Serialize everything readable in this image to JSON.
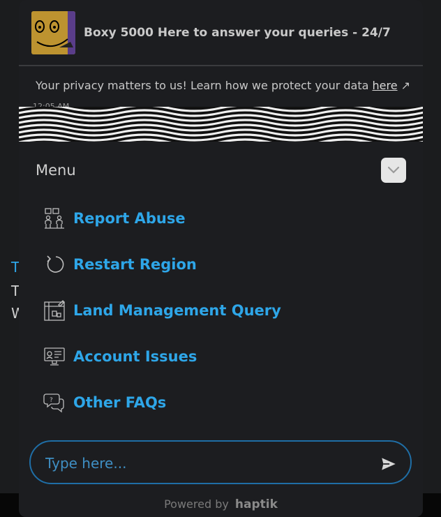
{
  "background": {
    "lines": [
      "T",
      "T",
      "W"
    ]
  },
  "header": {
    "title": "Boxy 5000 Here to answer your queries - 24/7",
    "avatar_icon": "boxy-avatar-icon"
  },
  "privacy": {
    "text": "Your privacy matters to us! Learn how we protect your data ",
    "link_label": "here",
    "arrow": "↗"
  },
  "chat": {
    "timestamp": "12:05 AM"
  },
  "menu": {
    "title": "Menu",
    "collapse_icon": "chevron-down-icon",
    "items": [
      {
        "label": "Report Abuse",
        "icon": "report-abuse-icon"
      },
      {
        "label": "Restart Region",
        "icon": "restart-icon"
      },
      {
        "label": "Land Management Query",
        "icon": "land-management-icon"
      },
      {
        "label": "Account Issues",
        "icon": "account-issues-icon"
      },
      {
        "label": "Other FAQs",
        "icon": "faq-chat-icon"
      }
    ]
  },
  "composer": {
    "placeholder": "Type here...",
    "send_icon": "send-icon"
  },
  "footer": {
    "powered_by": "Powered by",
    "brand": "haptik"
  },
  "colors": {
    "accent": "#2ea6e8",
    "border_accent": "#1f6ea6",
    "panel": "#1c1d20"
  }
}
